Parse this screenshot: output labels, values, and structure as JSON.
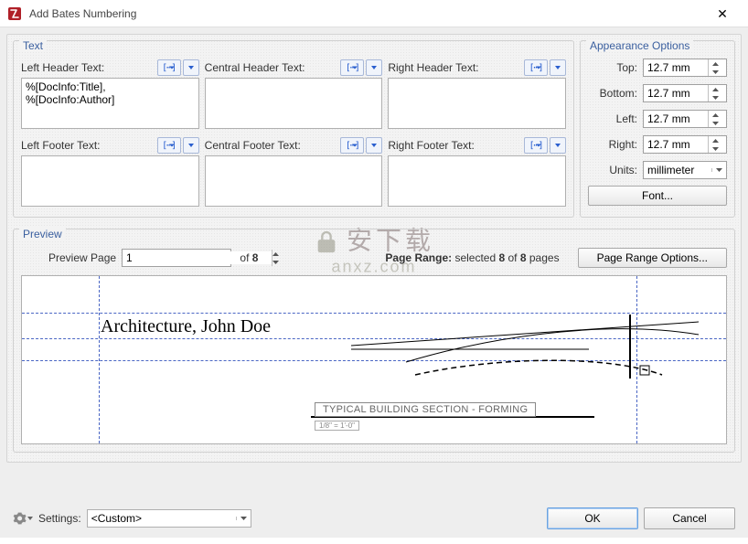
{
  "window": {
    "title": "Add Bates Numbering",
    "close_glyph": "✕"
  },
  "text_section": {
    "legend": "Text",
    "macro_btn_glyph": "[⋯]",
    "fields": {
      "left_header": {
        "label": "Left Header Text:",
        "value": "%[DocInfo:Title], %[DocInfo:Author]"
      },
      "central_header": {
        "label": "Central Header Text:",
        "value": ""
      },
      "right_header": {
        "label": "Right Header Text:",
        "value": ""
      },
      "left_footer": {
        "label": "Left Footer Text:",
        "value": ""
      },
      "central_footer": {
        "label": "Central Footer Text:",
        "value": ""
      },
      "right_footer": {
        "label": "Right Footer Text:",
        "value": ""
      }
    }
  },
  "appearance": {
    "legend": "Appearance Options",
    "top_label": "Top:",
    "top_value": "12.7 mm",
    "bottom_label": "Bottom:",
    "bottom_value": "12.7 mm",
    "left_label": "Left:",
    "left_value": "12.7 mm",
    "right_label": "Right:",
    "right_value": "12.7 mm",
    "units_label": "Units:",
    "units_value": "millimeter",
    "font_btn": "Font..."
  },
  "preview": {
    "legend": "Preview",
    "preview_page_label": "Preview Page",
    "preview_page_value": "1",
    "of_label": "of",
    "total_pages": "8",
    "page_range_prefix": "Page Range:",
    "page_range_text": " selected ",
    "page_range_sel": "8",
    "page_range_of": " of ",
    "page_range_tot": "8",
    "page_range_suffix": " pages",
    "page_range_btn": "Page Range Options...",
    "header_rendered": "Architecture, John Doe",
    "section_label": "TYPICAL BUILDING SECTION - FORMING",
    "section_small": "1/8\" = 1'-0\""
  },
  "bottom": {
    "settings_label": "Settings:",
    "settings_value": "<Custom>",
    "ok": "OK",
    "cancel": "Cancel"
  },
  "watermark": {
    "line1": "安下载",
    "line2": "anxz.com"
  }
}
